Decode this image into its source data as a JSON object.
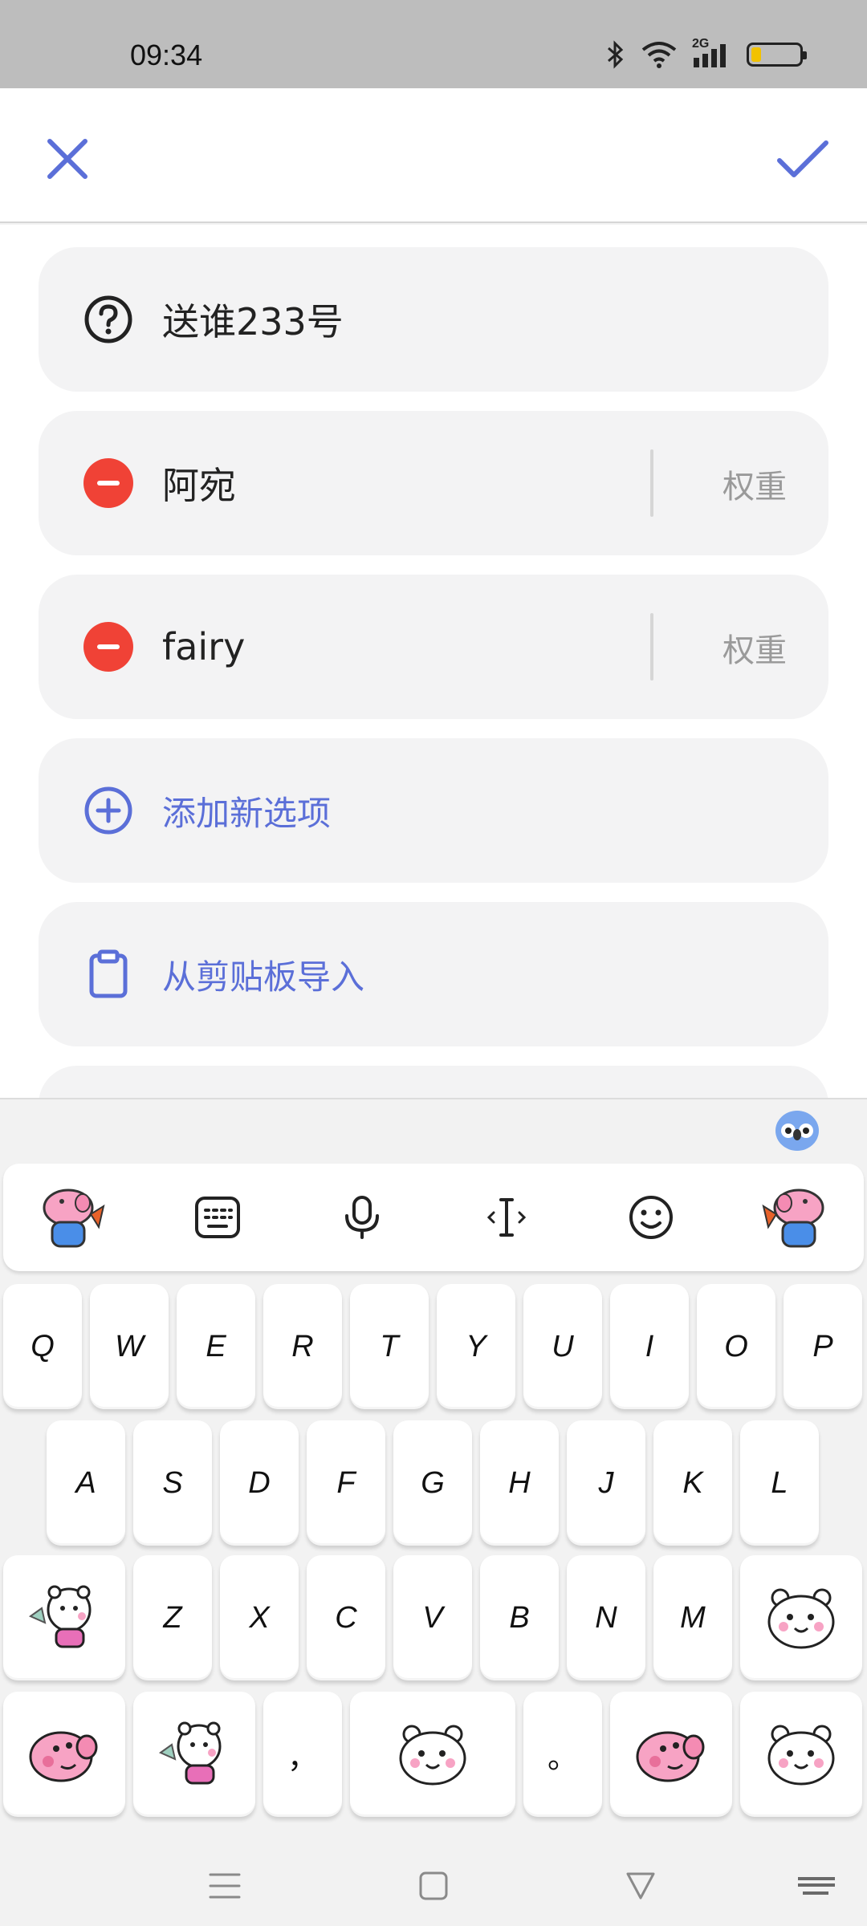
{
  "status_bar": {
    "time": "09:34",
    "network": "2G"
  },
  "app_bar": {
    "close_icon": "close-icon",
    "confirm_icon": "check-icon",
    "accent_color": "#5b6fd8"
  },
  "question": {
    "icon": "help-circle-icon",
    "text": "送谁233号"
  },
  "options": [
    {
      "icon": "remove-circle-icon",
      "label": "阿宛",
      "weight_placeholder": "权重"
    },
    {
      "icon": "remove-circle-icon",
      "label": "fairy",
      "weight_placeholder": "权重"
    }
  ],
  "actions": [
    {
      "icon": "add-circle-icon",
      "label": "添加新选项"
    },
    {
      "icon": "clipboard-icon",
      "label": "从剪贴板导入"
    }
  ],
  "keyboard": {
    "toolbar": [
      "pig-sticker",
      "keyboard-layout-icon",
      "microphone-icon",
      "cursor-icon",
      "emoji-icon",
      "pig-sticker"
    ],
    "row1": [
      "Q",
      "W",
      "E",
      "R",
      "T",
      "Y",
      "U",
      "I",
      "O",
      "P"
    ],
    "row2": [
      "A",
      "S",
      "D",
      "F",
      "G",
      "H",
      "J",
      "K",
      "L"
    ],
    "row3": [
      "Z",
      "X",
      "C",
      "V",
      "B",
      "N",
      "M"
    ],
    "comma": "，",
    "period": "。"
  },
  "nav_bar": [
    "menu-icon",
    "home-icon",
    "back-icon",
    "keyboard-icon"
  ]
}
